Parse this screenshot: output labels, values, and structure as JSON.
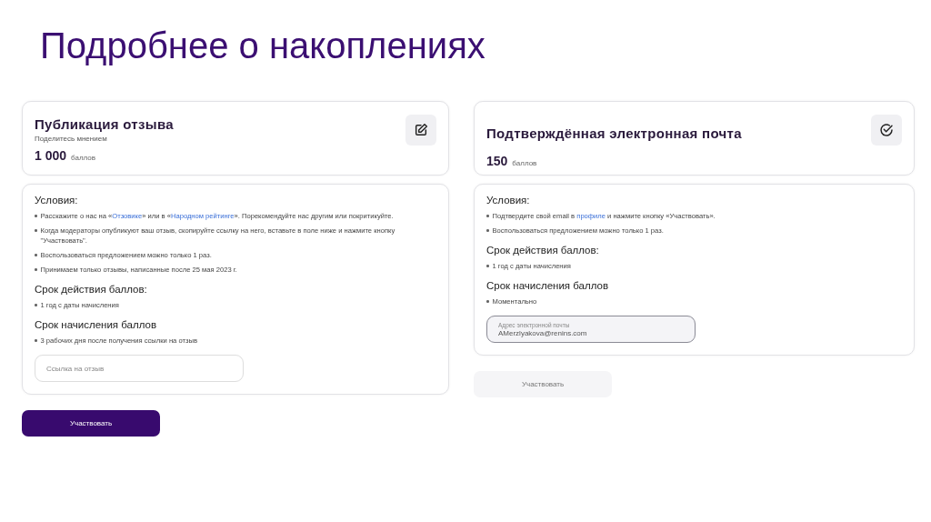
{
  "title": "Подробнее о накоплениях",
  "offers": [
    {
      "kind": "review",
      "title": "Публикация отзыва",
      "subtitle": "Поделитесь мнением",
      "points": "1 000",
      "points_unit": "баллов",
      "sections": [
        {
          "heading": "Условия:",
          "items": [
            [
              {
                "text": "Расскажите о нас на «"
              },
              {
                "text": "Отзовике",
                "link": true
              },
              {
                "text": "» или в «"
              },
              {
                "text": "Народном рейтинге",
                "link": true
              },
              {
                "text": "». Порекомендуйте нас другим или покритикуйте."
              }
            ],
            [
              {
                "text": "Когда модераторы опубликуют ваш отзыв, скопируйте ссылку на него, вставьте в поле ниже и нажмите кнопку \"Участвовать\"."
              }
            ],
            [
              {
                "text": "Воспользоваться предложением можно только 1 раз."
              }
            ],
            [
              {
                "text": "Принимаем только отзывы, написанные после 25 мая 2023 г."
              }
            ]
          ]
        },
        {
          "heading": "Срок действия баллов:",
          "items": [
            [
              {
                "text": "1 год с даты начисления"
              }
            ]
          ]
        },
        {
          "heading": "Срок начисления баллов",
          "items": [
            [
              {
                "text": "3 рабочих дня после получения ссылки на отзыв"
              }
            ]
          ]
        }
      ],
      "field": {
        "placeholder": "Ссылка на отзыв"
      },
      "button": {
        "label": "Участвовать",
        "disabled": false
      }
    },
    {
      "kind": "email",
      "title": "Подтверждённая электронная почта",
      "points": "150",
      "points_unit": "баллов",
      "sections": [
        {
          "heading": "Условия:",
          "items": [
            [
              {
                "text": "Подтвердите свой email в "
              },
              {
                "text": "профиле",
                "link": true
              },
              {
                "text": " и нажмите кнопку «Участвовать»."
              }
            ],
            [
              {
                "text": "Воспользоваться предложением можно только 1 раз."
              }
            ]
          ]
        },
        {
          "heading": "Срок действия баллов:",
          "items": [
            [
              {
                "text": "1 год с даты начисления"
              }
            ]
          ]
        },
        {
          "heading": "Срок начисления баллов",
          "items": [
            [
              {
                "text": "Моментально"
              }
            ]
          ]
        }
      ],
      "field": {
        "label": "Адрес электронной почты",
        "value": "AMerzlyakova@renins.com"
      },
      "button": {
        "label": "Участвовать",
        "disabled": true
      }
    }
  ]
}
